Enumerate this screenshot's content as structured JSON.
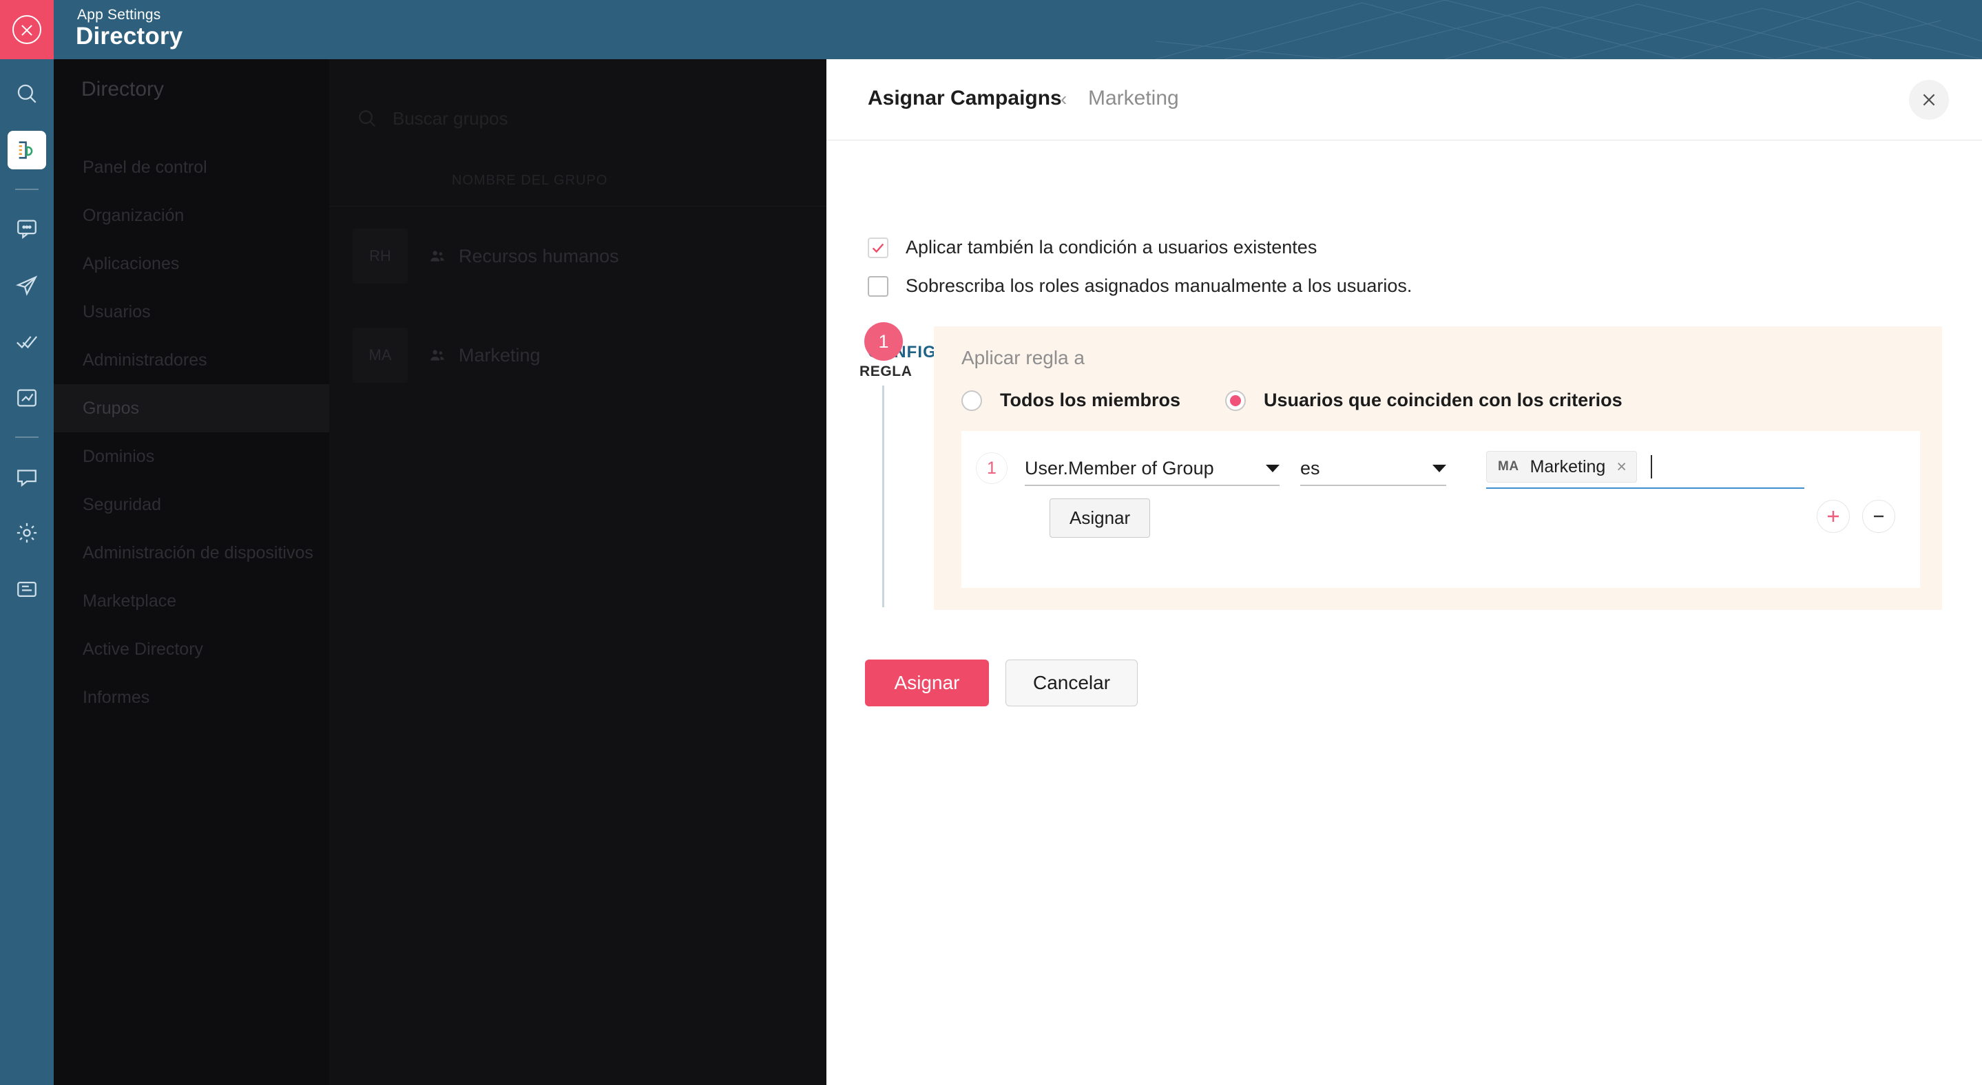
{
  "app": {
    "kicker": "App Settings",
    "title": "Directory",
    "close_icon": "close-circle-icon"
  },
  "rail": {
    "items": [
      {
        "name": "search-icon",
        "label": "Search"
      },
      {
        "name": "directory-icon",
        "label": "Directory",
        "active": true
      },
      {
        "name": "chat-icon",
        "label": "Chat"
      },
      {
        "name": "mail-icon",
        "label": "Mail"
      },
      {
        "name": "tasks-icon",
        "label": "Tasks"
      },
      {
        "name": "analytics-icon",
        "label": "Analytics"
      },
      {
        "name": "connect-icon",
        "label": "Connect"
      },
      {
        "name": "settings-icon",
        "label": "Settings"
      },
      {
        "name": "docs-icon",
        "label": "Docs"
      }
    ]
  },
  "nav": {
    "heading": "Directory",
    "items": [
      {
        "label": "Panel de control",
        "selected": false
      },
      {
        "label": "Organización",
        "selected": false
      },
      {
        "label": "Aplicaciones",
        "selected": false
      },
      {
        "label": "Usuarios",
        "selected": false
      },
      {
        "label": "Administradores",
        "selected": false
      },
      {
        "label": "Grupos",
        "selected": true
      },
      {
        "label": "Dominios",
        "selected": false
      },
      {
        "label": "Seguridad",
        "selected": false
      },
      {
        "label": "Administración de dispositivos",
        "selected": false
      },
      {
        "label": "Marketplace",
        "selected": false
      },
      {
        "label": "Active Directory",
        "selected": false
      },
      {
        "label": "Informes",
        "selected": false
      }
    ]
  },
  "groups": {
    "search_placeholder": "Buscar grupos",
    "column_header": "NOMBRE DEL GRUPO",
    "rows": [
      {
        "initials": "RH",
        "name": "Recursos humanos"
      },
      {
        "initials": "MA",
        "name": "Marketing"
      }
    ]
  },
  "panel": {
    "title": "Asignar Campaigns",
    "chevron": "‹",
    "subtitle": "Marketing",
    "close_icon": "close-icon",
    "checkboxes": [
      {
        "label": "Aplicar también la condición a usuarios existentes",
        "checked": true
      },
      {
        "label": "Sobrescriba los roles asignados manualmente a los usuarios.",
        "checked": false
      }
    ],
    "section_title": "CONFIGURE LA CONDICIÓN",
    "rule": {
      "number": "1",
      "word": "REGLA",
      "apply_label": "Aplicar regla a",
      "options": [
        {
          "label": "Todos los miembros",
          "selected": false
        },
        {
          "label": "Usuarios que coinciden con los criterios",
          "selected": true
        }
      ],
      "condition": {
        "index": "1",
        "attribute": "User.Member of Group",
        "operator": "es",
        "tag": {
          "initials": "MA",
          "name": "Marketing",
          "remove_icon": "close-icon"
        },
        "inner_button": "Asignar",
        "add_icon": "plus-icon",
        "remove_icon": "minus-icon"
      }
    },
    "actions": {
      "primary": "Asignar",
      "secondary": "Cancelar"
    }
  },
  "colors": {
    "brand_pink": "#ef4b68",
    "header_teal": "#2e5f7c",
    "section_blue": "#1f6287",
    "rule_card_bg": "#fdf4ec",
    "focus_blue": "#3f8fd0"
  }
}
